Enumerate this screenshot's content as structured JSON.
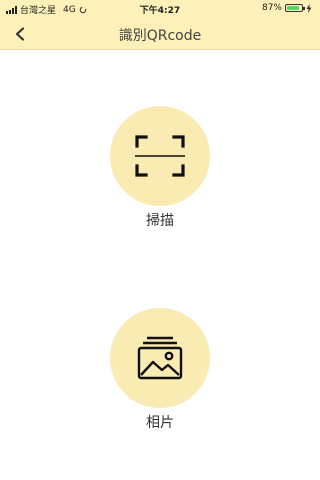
{
  "status_bar": {
    "carrier": "台灣之星",
    "network": "4G",
    "time": "下午4:27",
    "battery_percent": "87%",
    "battery_level": 0.87
  },
  "nav": {
    "title": "識別QRcode"
  },
  "actions": [
    {
      "label": "掃描",
      "icon": "scan-frame-icon"
    },
    {
      "label": "相片",
      "icon": "photo-gallery-icon"
    }
  ],
  "colors": {
    "header_bg": "#fdf0b8",
    "circle_bg": "#faebb3",
    "battery_green": "#4cd964"
  }
}
